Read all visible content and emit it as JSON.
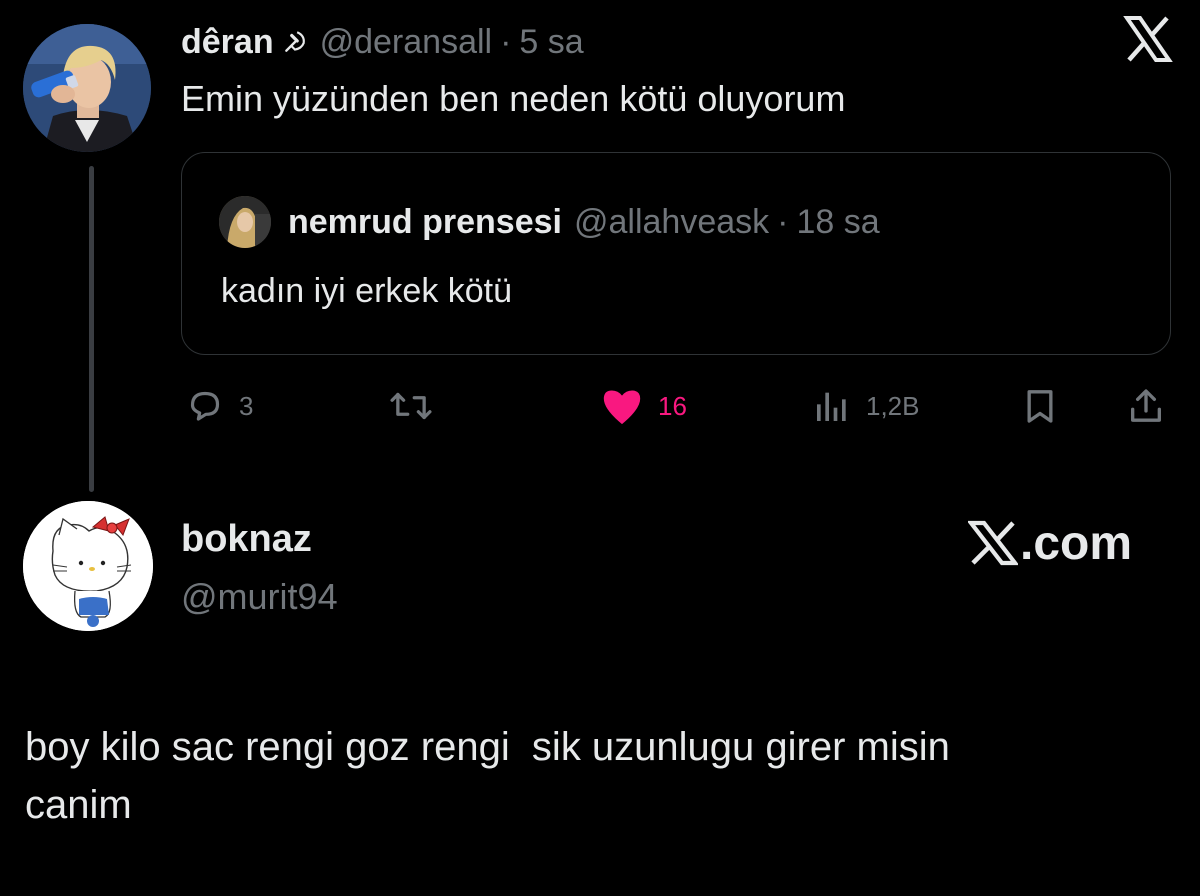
{
  "top_tweet": {
    "display_name": "dêran",
    "name_emoji": "☭",
    "handle": "@deransall",
    "separator": "·",
    "time": "5 sa",
    "text": "Emin yüzünden ben neden kötü oluyorum",
    "logo_icon": "x-logo-icon"
  },
  "quoted_tweet": {
    "display_name": "nemrud prensesi",
    "handle": "@allahveask",
    "separator": "·",
    "time": "18 sa",
    "text": "kadın iyi erkek kötü"
  },
  "actions": {
    "reply_count": "3",
    "like_count": "16",
    "view_count": "1,2B",
    "liked": true,
    "like_color": "#f91880"
  },
  "reply_card": {
    "display_name": "boknaz",
    "handle": "@murit94",
    "brand_text": ".com",
    "text": "boy kilo sac rengi goz rengi  sik uzunlugu girer misin\ncanim"
  },
  "colors": {
    "background": "#000000",
    "text_primary": "#e7e9ea",
    "text_muted": "#71767b",
    "border": "#2f3336"
  }
}
